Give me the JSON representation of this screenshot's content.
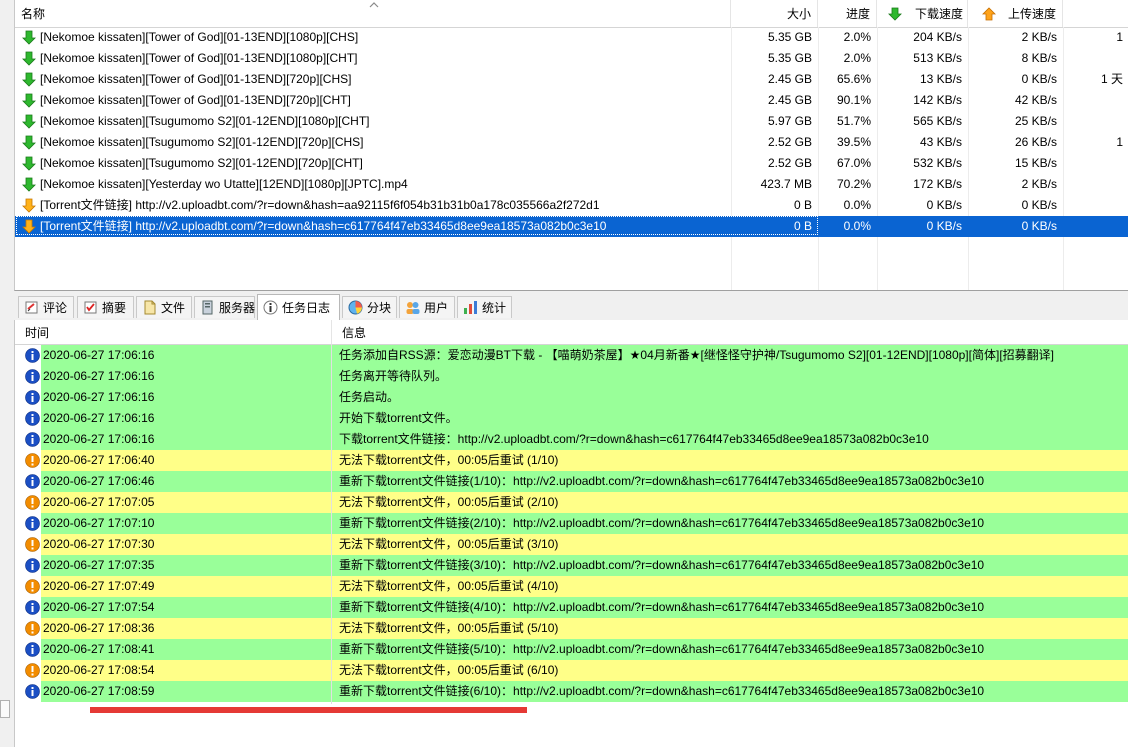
{
  "download_list": {
    "columns": {
      "name": "名称",
      "size": "大小",
      "progress": "进度",
      "dl_speed": "下载速度",
      "ul_speed": "上传速度"
    },
    "rows": [
      {
        "name": "[Nekomoe kissaten][Tower of God][01-13END][1080p][CHS]",
        "size": "5.35 GB",
        "progress": "2.0%",
        "dl": "204 KB/s",
        "ul": "2 KB/s",
        "extra": "1",
        "icon": "green-down-arrow-icon"
      },
      {
        "name": "[Nekomoe kissaten][Tower of God][01-13END][1080p][CHT]",
        "size": "5.35 GB",
        "progress": "2.0%",
        "dl": "513 KB/s",
        "ul": "8 KB/s",
        "extra": "",
        "icon": "green-down-arrow-icon"
      },
      {
        "name": "[Nekomoe kissaten][Tower of God][01-13END][720p][CHS]",
        "size": "2.45 GB",
        "progress": "65.6%",
        "dl": "13 KB/s",
        "ul": "0 KB/s",
        "extra": "1 天",
        "icon": "green-down-arrow-icon"
      },
      {
        "name": "[Nekomoe kissaten][Tower of God][01-13END][720p][CHT]",
        "size": "2.45 GB",
        "progress": "90.1%",
        "dl": "142 KB/s",
        "ul": "42 KB/s",
        "extra": "",
        "icon": "green-down-arrow-icon"
      },
      {
        "name": "[Nekomoe kissaten][Tsugumomo S2][01-12END][1080p][CHT]",
        "size": "5.97 GB",
        "progress": "51.7%",
        "dl": "565 KB/s",
        "ul": "25 KB/s",
        "extra": "",
        "icon": "green-down-arrow-icon"
      },
      {
        "name": "[Nekomoe kissaten][Tsugumomo S2][01-12END][720p][CHS]",
        "size": "2.52 GB",
        "progress": "39.5%",
        "dl": "43 KB/s",
        "ul": "26 KB/s",
        "extra": "1",
        "icon": "green-down-arrow-icon"
      },
      {
        "name": "[Nekomoe kissaten][Tsugumomo S2][01-12END][720p][CHT]",
        "size": "2.52 GB",
        "progress": "67.0%",
        "dl": "532 KB/s",
        "ul": "15 KB/s",
        "extra": "",
        "icon": "green-down-arrow-icon"
      },
      {
        "name": "[Nekomoe kissaten][Yesterday wo Utatte][12END][1080p][JPTC].mp4",
        "size": "423.7 MB",
        "progress": "70.2%",
        "dl": "172 KB/s",
        "ul": "2 KB/s",
        "extra": "",
        "icon": "green-down-arrow-icon"
      },
      {
        "name": "[Torrent文件链接] http://v2.uploadbt.com/?r=down&hash=aa92115f6f054b31b31b0a178c035566a2f272d1",
        "size": "0 B",
        "progress": "0.0%",
        "dl": "0 KB/s",
        "ul": "0 KB/s",
        "extra": "",
        "icon": "yellow-down-arrow-icon"
      },
      {
        "name": "[Torrent文件链接] http://v2.uploadbt.com/?r=down&hash=c617764f47eb33465d8ee9ea18573a082b0c3e10",
        "size": "0 B",
        "progress": "0.0%",
        "dl": "0 KB/s",
        "ul": "0 KB/s",
        "extra": "",
        "icon": "yellow-down-arrow-icon",
        "selected": true
      }
    ]
  },
  "tabs": [
    {
      "label": "评论",
      "icon": "comment-icon"
    },
    {
      "label": "摘要",
      "icon": "checklist-icon"
    },
    {
      "label": "文件",
      "icon": "file-icon"
    },
    {
      "label": "服务器",
      "icon": "server-icon"
    },
    {
      "label": "任务日志",
      "icon": "info-icon",
      "active": true
    },
    {
      "label": "分块",
      "icon": "pie-chart-icon"
    },
    {
      "label": "用户",
      "icon": "users-icon"
    },
    {
      "label": "统计",
      "icon": "stats-icon"
    }
  ],
  "log": {
    "columns": {
      "time": "时间",
      "message": "信息"
    },
    "colors": {
      "info_bg": "#99ff99",
      "warn_bg": "#ffff88",
      "selected_bg": "#0a64d2"
    },
    "entries": [
      {
        "type": "info",
        "time": "2020-06-27 17:06:16",
        "message": "任务添加自RSS源：爱恋动漫BT下载 - 【喵萌奶茶屋】★04月新番★[继怪怪守护神/Tsugumomo S2][01-12END][1080p][简体][招募翻译]"
      },
      {
        "type": "info",
        "time": "2020-06-27 17:06:16",
        "message": "任务离开等待队列。"
      },
      {
        "type": "info",
        "time": "2020-06-27 17:06:16",
        "message": "任务启动。"
      },
      {
        "type": "info",
        "time": "2020-06-27 17:06:16",
        "message": "开始下载torrent文件。"
      },
      {
        "type": "info",
        "time": "2020-06-27 17:06:16",
        "message": "下载torrent文件链接：http://v2.uploadbt.com/?r=down&hash=c617764f47eb33465d8ee9ea18573a082b0c3e10"
      },
      {
        "type": "warn",
        "time": "2020-06-27 17:06:40",
        "message": "无法下载torrent文件，00:05后重试 (1/10)"
      },
      {
        "type": "info",
        "time": "2020-06-27 17:06:46",
        "message": "重新下载torrent文件链接(1/10)：http://v2.uploadbt.com/?r=down&hash=c617764f47eb33465d8ee9ea18573a082b0c3e10"
      },
      {
        "type": "warn",
        "time": "2020-06-27 17:07:05",
        "message": "无法下载torrent文件，00:05后重试 (2/10)"
      },
      {
        "type": "info",
        "time": "2020-06-27 17:07:10",
        "message": "重新下载torrent文件链接(2/10)：http://v2.uploadbt.com/?r=down&hash=c617764f47eb33465d8ee9ea18573a082b0c3e10"
      },
      {
        "type": "warn",
        "time": "2020-06-27 17:07:30",
        "message": "无法下载torrent文件，00:05后重试 (3/10)"
      },
      {
        "type": "info",
        "time": "2020-06-27 17:07:35",
        "message": "重新下载torrent文件链接(3/10)：http://v2.uploadbt.com/?r=down&hash=c617764f47eb33465d8ee9ea18573a082b0c3e10"
      },
      {
        "type": "warn",
        "time": "2020-06-27 17:07:49",
        "message": "无法下载torrent文件，00:05后重试 (4/10)"
      },
      {
        "type": "info",
        "time": "2020-06-27 17:07:54",
        "message": "重新下载torrent文件链接(4/10)：http://v2.uploadbt.com/?r=down&hash=c617764f47eb33465d8ee9ea18573a082b0c3e10"
      },
      {
        "type": "warn",
        "time": "2020-06-27 17:08:36",
        "message": "无法下载torrent文件，00:05后重试 (5/10)"
      },
      {
        "type": "info",
        "time": "2020-06-27 17:08:41",
        "message": "重新下载torrent文件链接(5/10)：http://v2.uploadbt.com/?r=down&hash=c617764f47eb33465d8ee9ea18573a082b0c3e10"
      },
      {
        "type": "warn",
        "time": "2020-06-27 17:08:54",
        "message": "无法下载torrent文件，00:05后重试 (6/10)"
      },
      {
        "type": "info",
        "time": "2020-06-27 17:08:59",
        "message": "重新下载torrent文件链接(6/10)：http://v2.uploadbt.com/?r=down&hash=c617764f47eb33465d8ee9ea18573a082b0c3e10"
      }
    ]
  }
}
